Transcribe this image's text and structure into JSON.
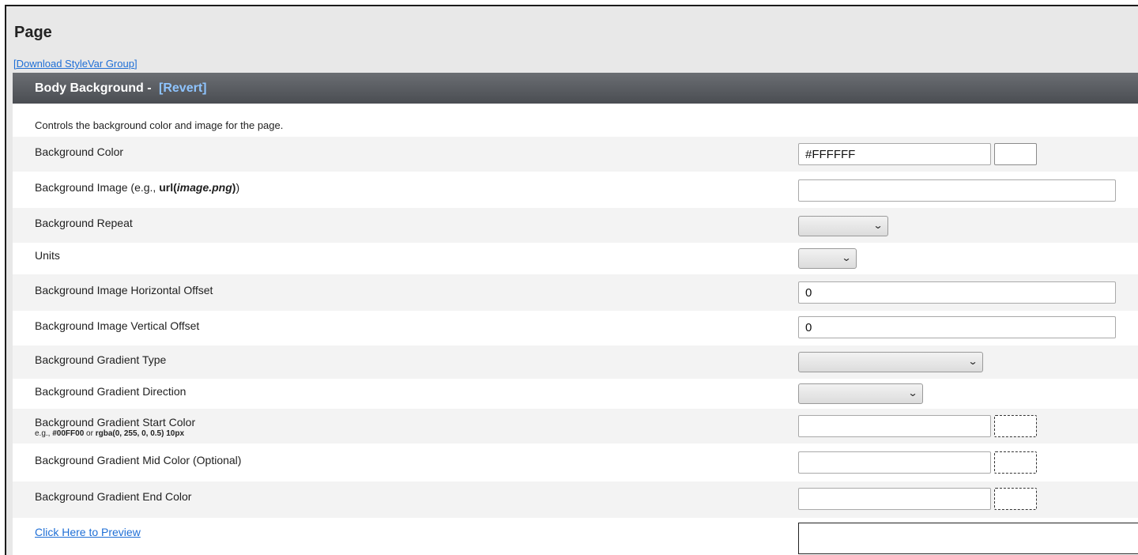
{
  "page": {
    "title": "Page",
    "download_link": "[Download StyleVar Group]"
  },
  "section": {
    "title": "Body Background - ",
    "revert": "[Revert]",
    "description": "Controls the background color and image for the page."
  },
  "fields": {
    "bg_color": {
      "label": "Background Color",
      "value": "#FFFFFF",
      "swatch_color": "#FFFFFF"
    },
    "bg_image": {
      "label_prefix": "Background Image (e.g., ",
      "label_code_a": "url(",
      "label_code_b": "image.png",
      "label_code_c": ")",
      "label_suffix": ")",
      "value": ""
    },
    "bg_repeat": {
      "label": "Background Repeat",
      "value": ""
    },
    "units": {
      "label": "Units",
      "value": ""
    },
    "h_offset": {
      "label": "Background Image Horizontal Offset",
      "value": "0"
    },
    "v_offset": {
      "label": "Background Image Vertical Offset",
      "value": "0"
    },
    "gradient_type": {
      "label": "Background Gradient Type",
      "value": ""
    },
    "gradient_direction": {
      "label": "Background Gradient Direction",
      "value": ""
    },
    "gradient_start": {
      "label": "Background Gradient Start Color",
      "hint_prefix": "e.g., ",
      "hint_a": "#00FF00",
      "hint_mid": " or ",
      "hint_b": "rgba(0, 255, 0, 0.5) 10px",
      "value": ""
    },
    "gradient_mid": {
      "label": "Background Gradient Mid Color (Optional)",
      "value": ""
    },
    "gradient_end": {
      "label": "Background Gradient End Color",
      "value": ""
    }
  },
  "preview": {
    "link": "Click Here to Preview"
  },
  "icons": {
    "select_chevron": "chevron-down-icon"
  },
  "colors": {
    "header_bg": "#55585d",
    "revert_link": "#8ec4ff",
    "link": "#1f6fd6",
    "row_shade": "#f3f3f3"
  }
}
